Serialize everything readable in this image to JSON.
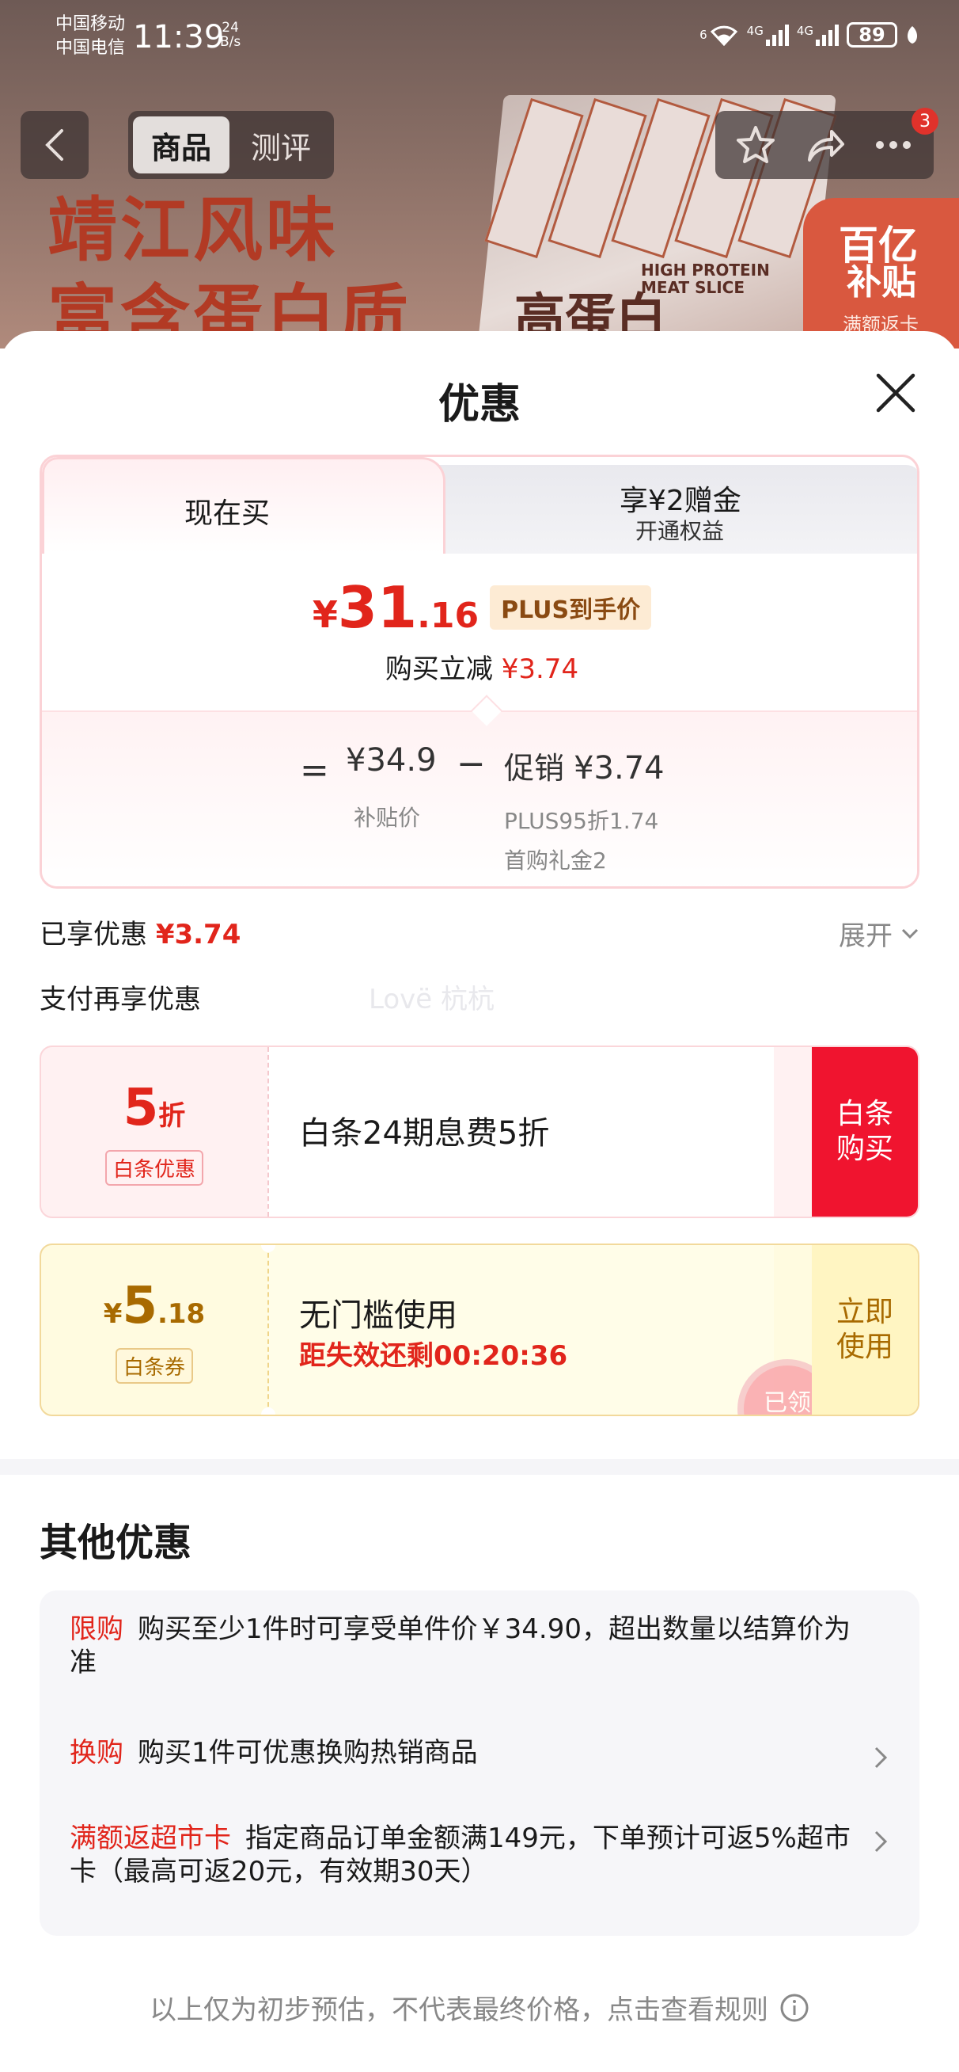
{
  "status_bar": {
    "carrier_1": "中国移动",
    "carrier_2": "中国电信",
    "time": "11:39",
    "speed_value": "24",
    "speed_unit": "B/s",
    "net_1": "6",
    "net_2": "4G",
    "net_3": "4G",
    "battery": "89"
  },
  "background": {
    "slogan_1": "靖江风味",
    "slogan_2": "富含蛋白质",
    "box_text": "高蛋白",
    "box_sub_1": "HIGH PROTEIN",
    "box_sub_2": "MEAT SLICE",
    "badge_1": "百亿",
    "badge_2": "补贴",
    "badge_3": "满额返卡"
  },
  "nav": {
    "tabs": [
      {
        "label": "商品",
        "active": true
      },
      {
        "label": "测评",
        "active": false
      }
    ],
    "notification_count": "3"
  },
  "sheet": {
    "title": "优惠",
    "buy_now_tab": "现在买",
    "bonus_tab_title": "享¥2赠金",
    "bonus_tab_sub": "开通权益",
    "price_currency": "¥",
    "price_integer": "31",
    "price_decimal": ".16",
    "plus_tag": "PLUS到手价",
    "reduce_label": "购买立减",
    "reduce_amount": "¥3.74",
    "equals": "=",
    "base_price": "¥34.9",
    "base_price_label": "补贴价",
    "minus": "−",
    "promo_label": "促销",
    "promo_amount": "¥3.74",
    "promo_detail_1": "PLUS95折1.74",
    "promo_detail_2": "首购礼金2",
    "enjoyed_label": "已享优惠",
    "enjoyed_amount": "¥3.74",
    "expand_label": "展开",
    "pay_more_label": "支付再享优惠",
    "watermark": "Lovë 杭杭"
  },
  "coupons": [
    {
      "value": "5",
      "unit": "折",
      "tag": "白条优惠",
      "text": "白条24期息费5折",
      "button": "白条\n购买"
    },
    {
      "currency": "¥",
      "value": "5",
      "decimal": ".18",
      "tag": "白条券",
      "text": "无门槛使用",
      "countdown": "距失效还剩00:20:36",
      "button": "立即\n使用",
      "stamp": "已领"
    }
  ],
  "other": {
    "title": "其他优惠",
    "rules": [
      {
        "key": "限购",
        "text": "购买至少1件时可享受单件价￥34.90，超出数量以结算价为准",
        "has_arrow": false
      },
      {
        "key": "换购",
        "text": "购买1件可优惠换购热销商品",
        "has_arrow": true
      },
      {
        "key": "满额返超市卡",
        "text": "指定商品订单金额满149元，下单预计可返5%超市卡（最高可返20元，有效期30天）",
        "has_arrow": true
      }
    ]
  },
  "footer": "以上仅为初步预估，不代表最终价格，点击查看规则",
  "colors": {
    "accent_red": "#e1251b",
    "button_red": "#f0142f",
    "coupon_gold": "#a86a00"
  }
}
